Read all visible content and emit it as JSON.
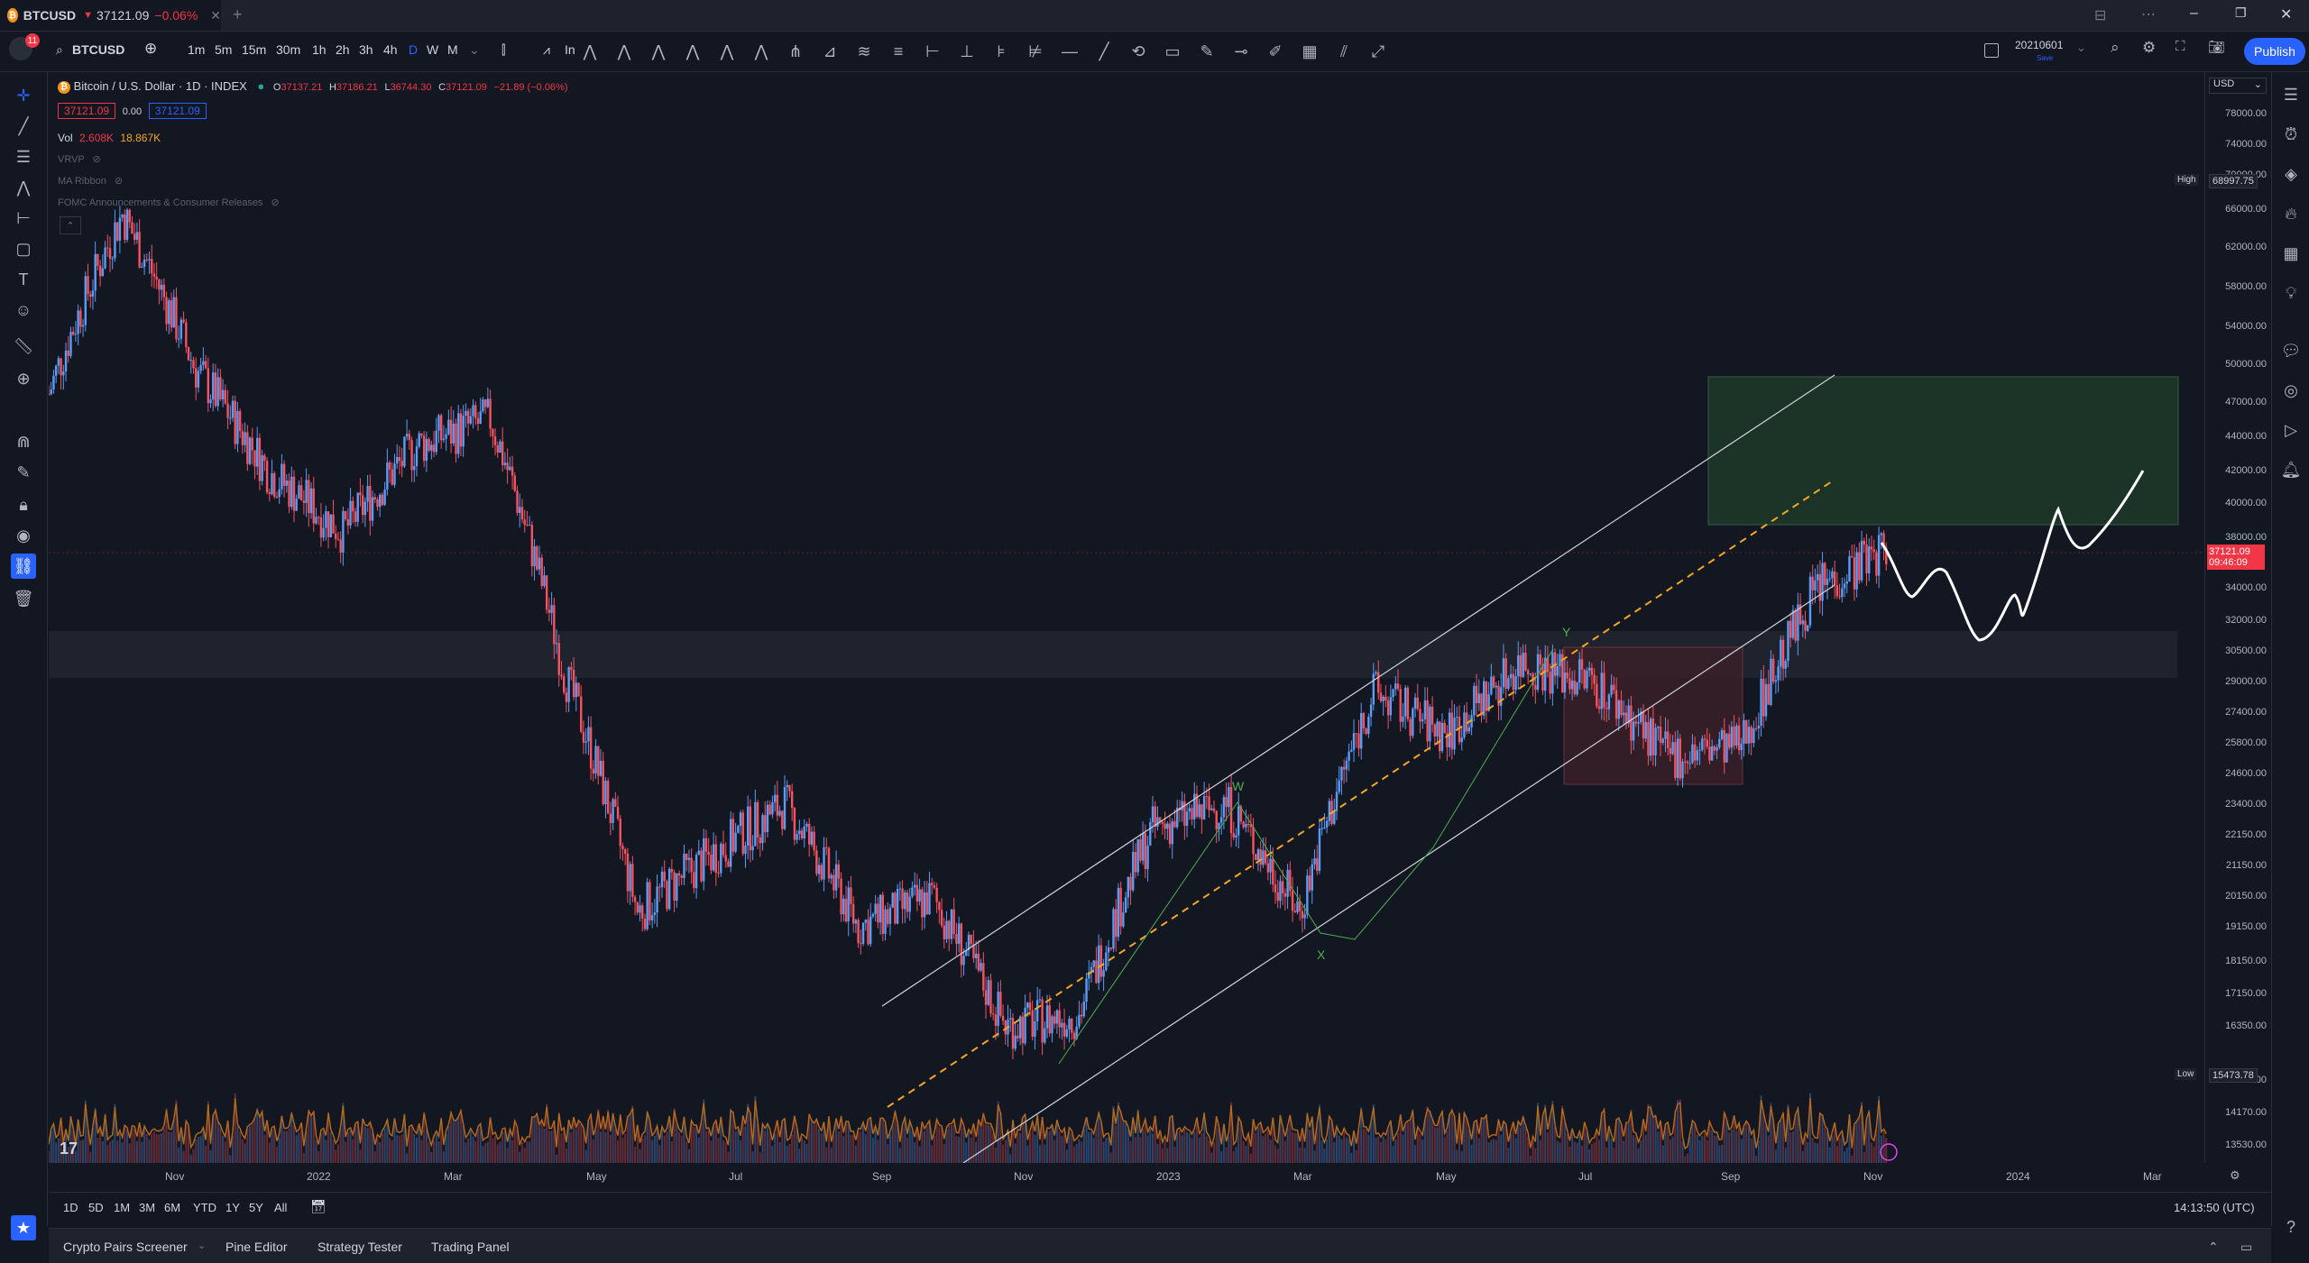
{
  "tab": {
    "symbol": "BTCUSD",
    "price": "37121.09",
    "change": "▼",
    "change_pct": "−0.06%",
    "notif": "11"
  },
  "toolbar": {
    "symbol": "BTCUSD",
    "intervals": [
      "1m",
      "5m",
      "15m",
      "30m",
      "1h",
      "2h",
      "3h",
      "4h",
      "D",
      "W",
      "M"
    ],
    "active_interval": "D",
    "indicators_label": "In",
    "save_date": "20210601",
    "save_label": "Save",
    "publish": "Publish"
  },
  "legend": {
    "title": "Bitcoin / U.S. Dollar · 1D · INDEX",
    "open_label": "O",
    "open": "37137.21",
    "high_label": "H",
    "high": "37186.21",
    "low_label": "L",
    "low": "36744.30",
    "close_label": "C",
    "close": "37121.09",
    "change": "−21.89 (−0.06%)",
    "sell": "37121.09",
    "spread": "0.00",
    "buy": "37121.09",
    "vol_label": "Vol",
    "vol1": "2.608K",
    "vol2": "18.867K",
    "ind1": "VRVP",
    "ind2": "MA Ribbon",
    "ind3": "FOMC Announcements & Consumer Releases"
  },
  "price_scale": {
    "currency": "USD",
    "labels": [
      "78000.00",
      "74000.00",
      "70000.00",
      "66000.00",
      "62000.00",
      "58000.00",
      "54000.00",
      "50000.00",
      "47000.00",
      "44000.00",
      "42000.00",
      "40000.00",
      "38000.00",
      "34000.00",
      "32000.00",
      "30500.00",
      "29000.00",
      "27400.00",
      "25800.00",
      "24600.00",
      "23400.00",
      "22150.00",
      "21150.00",
      "20150.00",
      "19150.00",
      "18150.00",
      "17150.00",
      "16350.00",
      "14850.00",
      "14170.00",
      "13530.00"
    ],
    "high_label": "High",
    "high_value": "68997.75",
    "low_label": "Low",
    "low_value": "15473.78",
    "current_price": "37121.09",
    "countdown": "09:46:09"
  },
  "time_axis": [
    "Nov",
    "2022",
    "Mar",
    "May",
    "Jul",
    "Sep",
    "Nov",
    "2023",
    "Mar",
    "May",
    "Jul",
    "Sep",
    "Nov",
    "2024",
    "Mar"
  ],
  "chart_annotations": {
    "w": "W",
    "x": "X",
    "y": "Y"
  },
  "time_range": {
    "buttons": [
      "1D",
      "5D",
      "1M",
      "3M",
      "6M",
      "YTD",
      "1Y",
      "5Y",
      "All"
    ],
    "clock": "14:13:50 (UTC)"
  },
  "bottom_tabs": [
    "Crypto Pairs Screener",
    "Pine Editor",
    "Strategy Tester",
    "Trading Panel"
  ],
  "colors": {
    "up": "#5b9cf6",
    "down": "#f7525f",
    "accent": "#2962ff",
    "bg": "#131722"
  },
  "chart_data": {
    "type": "candlestick",
    "title": "Bitcoin / U.S. Dollar · 1D · INDEX",
    "approx_path": [
      {
        "t": "2021-10",
        "p": 48000
      },
      {
        "t": "2021-11",
        "p": 65000
      },
      {
        "t": "2021-12",
        "p": 50000
      },
      {
        "t": "2022-01",
        "p": 42000
      },
      {
        "t": "2022-02",
        "p": 38000
      },
      {
        "t": "2022-03",
        "p": 44000
      },
      {
        "t": "2022-04",
        "p": 46000
      },
      {
        "t": "2022-05",
        "p": 30000
      },
      {
        "t": "2022-06",
        "p": 20000
      },
      {
        "t": "2022-07",
        "p": 22000
      },
      {
        "t": "2022-08",
        "p": 24000
      },
      {
        "t": "2022-09",
        "p": 19500
      },
      {
        "t": "2022-10",
        "p": 20500
      },
      {
        "t": "2022-11",
        "p": 16500
      },
      {
        "t": "2022-12",
        "p": 16800
      },
      {
        "t": "2023-01",
        "p": 23000
      },
      {
        "t": "2023-02",
        "p": 24000
      },
      {
        "t": "2023-03",
        "p": 20000
      },
      {
        "t": "2023-04",
        "p": 29000
      },
      {
        "t": "2023-05",
        "p": 27000
      },
      {
        "t": "2023-06",
        "p": 30500
      },
      {
        "t": "2023-07",
        "p": 29500
      },
      {
        "t": "2023-08",
        "p": 26000
      },
      {
        "t": "2023-09",
        "p": 26500
      },
      {
        "t": "2023-10",
        "p": 34500
      },
      {
        "t": "2023-11",
        "p": 37121.09
      }
    ]
  }
}
